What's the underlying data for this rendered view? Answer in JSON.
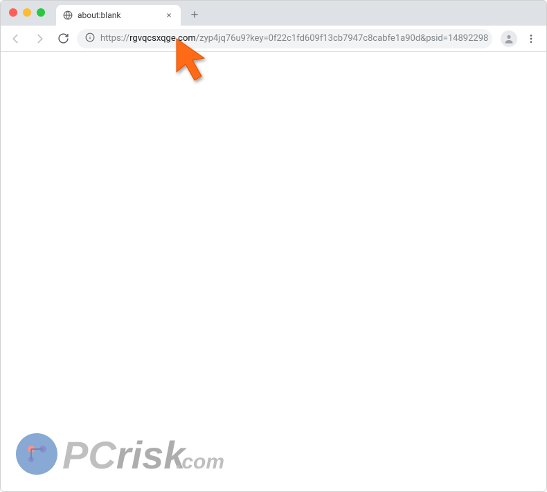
{
  "window": {
    "controls": {
      "close_color": "#ff5f57",
      "minimize_color": "#febc2e",
      "maximize_color": "#28c840"
    }
  },
  "tab": {
    "title": "about:blank"
  },
  "address": {
    "scheme": "https://",
    "domain": "rgvqcsxqge.com",
    "path": "/zyp4jq76u9?key=0f22c1fd609f13cb7947c8cabfe1a90d&psid=14892298"
  },
  "watermark": {
    "text_1": "PC",
    "text_2": "risk",
    "text_3": ".com"
  }
}
